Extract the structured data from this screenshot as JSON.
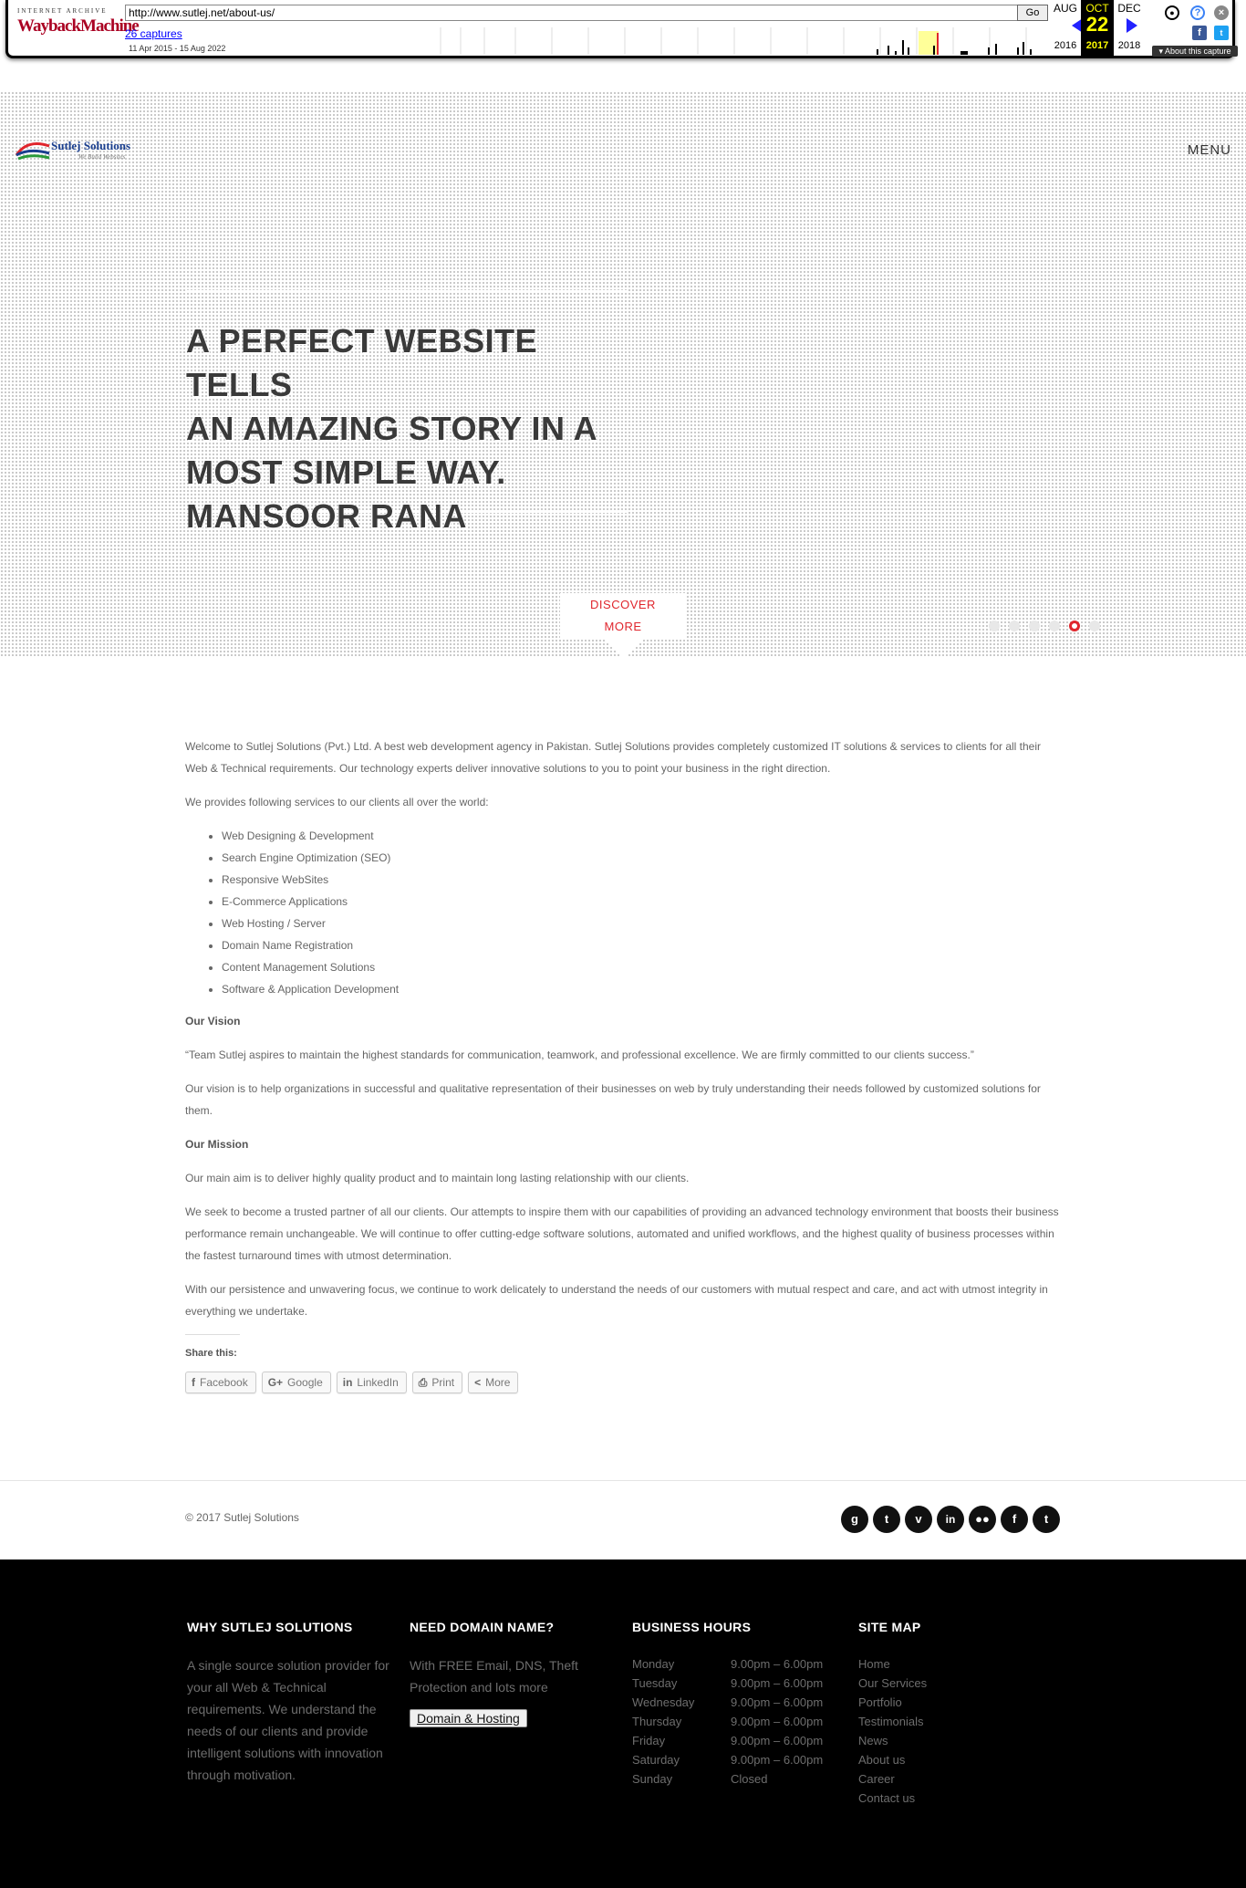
{
  "wayback": {
    "logo_top": "INTERNET ARCHIVE",
    "logo_main": "WaybackMachine",
    "url": "http://www.sutlej.net/about-us/",
    "go_label": "Go",
    "captures_link": "26 captures",
    "date_range": "11 Apr 2015 - 15 Aug 2022",
    "prev_month": "AUG",
    "current_month": "OCT",
    "next_month": "DEC",
    "prev_year": "2016",
    "current_day": "22",
    "current_year": "2017",
    "next_year": "2018",
    "about_capture": "▾ About this capture"
  },
  "header": {
    "logo_name": "Sutlej Solutions",
    "logo_tagline": "We Build Websites",
    "menu_label": "MENU"
  },
  "hero": {
    "quote_lines": [
      "A PERFECT WEBSITE TELLS",
      "AN AMAZING STORY IN A",
      "MOST SIMPLE WAY.",
      "MANSOOR RANA"
    ],
    "discover_line1": "DISCOVER",
    "discover_line2": "MORE",
    "active_slide": 5,
    "slide_count": 6
  },
  "content": {
    "intro": "Welcome to Sutlej Solutions (Pvt.) Ltd. A best web development agency in Pakistan. Sutlej Solutions provides completely customized IT solutions & services to clients for all their Web & Technical requirements. Our technology experts deliver innovative solutions to you to point your business in the right direction.",
    "services_intro": "We provides following services to our clients all over the world:",
    "services": [
      "Web Designing & Development",
      "Search Engine Optimization (SEO)",
      "Responsive WebSites",
      "E-Commerce Applications",
      "Web Hosting / Server",
      "Domain Name Registration",
      "Content Management Solutions",
      "Software & Application Development"
    ],
    "vision_title": "Our Vision",
    "vision_quote": "“Team Sutlej aspires to maintain the highest standards for communication, teamwork, and professional excellence. We are firmly committed to our clients success.”",
    "vision_text": "Our vision is to help organizations in successful and qualitative representation of their businesses on web by truly understanding their needs followed by customized solutions for them.",
    "mission_title": "Our Mission",
    "mission_p1": "Our main aim is to deliver highly quality product and to maintain long lasting relationship with our clients.",
    "mission_p2": "We seek to become a trusted partner of all our clients. Our attempts to inspire them with our capabilities of providing an advanced technology environment that boosts their business performance remain unchangeable. We will continue to offer cutting-edge software solutions, automated and unified workflows, and the highest quality of business processes within the fastest turnaround times with utmost determination.",
    "mission_p3": "With our persistence and unwavering focus, we continue to work delicately to understand the needs of our customers with mutual respect and care, and act with utmost integrity in everything we undertake.",
    "share_title": "Share this:",
    "share_buttons": [
      "Facebook",
      "Google",
      "LinkedIn",
      "Print",
      "More"
    ]
  },
  "footer_bar": {
    "copyright": "© 2017 Sutlej Solutions",
    "social_icons": [
      "google-plus-icon",
      "tumblr-icon",
      "vimeo-icon",
      "linkedin-icon",
      "flickr-icon",
      "facebook-icon",
      "twitter-icon"
    ]
  },
  "footer": {
    "why_title": "WHY SUTLEJ SOLUTIONS",
    "why_text": "A single source solution provider for your all Web & Technical requirements. We understand the needs of our clients and provide intelligent solutions with innovation through motivation.",
    "domain_title": "NEED DOMAIN NAME?",
    "domain_text": "With FREE Email, DNS, Theft Protection and lots more",
    "domain_button": "Domain & Hosting",
    "hours_title": "BUSINESS HOURS",
    "hours": [
      {
        "day": "Monday",
        "time": "9.00pm – 6.00pm"
      },
      {
        "day": "Tuesday",
        "time": "9.00pm – 6.00pm"
      },
      {
        "day": "Wednesday",
        "time": "9.00pm – 6.00pm"
      },
      {
        "day": "Thursday",
        "time": "9.00pm – 6.00pm"
      },
      {
        "day": "Friday",
        "time": "9.00pm – 6.00pm"
      },
      {
        "day": "Saturday",
        "time": "9.00pm – 6.00pm"
      },
      {
        "day": "Sunday",
        "time": "Closed"
      }
    ],
    "sitemap_title": "SITE MAP",
    "sitemap": [
      "Home",
      "Our Services",
      "Portfolio",
      "Testimonials",
      "News",
      "About us",
      "Career",
      "Contact us"
    ]
  },
  "colors": {
    "accent": "#e0262d",
    "footer_bg": "#000000",
    "wayback_highlight": "#ffff00",
    "link_blue": "#0000ff"
  }
}
